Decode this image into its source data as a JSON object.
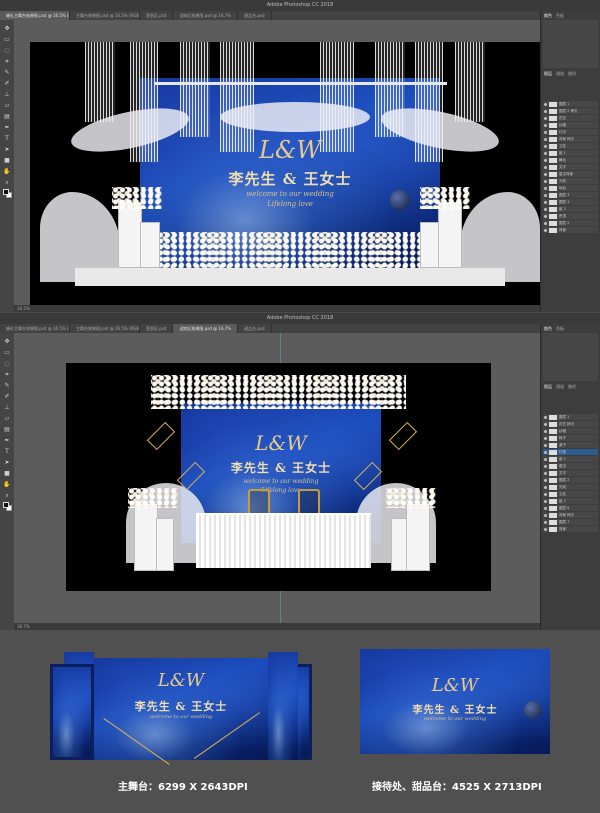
{
  "app": {
    "title": "Adobe Photoshop CC 2018",
    "tabs": [
      "婚礼主舞台效果图.psd @ 16.5% (图层 1, RGB/8)",
      "主舞台效果图.psd @ 16.5% (RGB/8)",
      "签到区.psd",
      "迎宾区效果图.psd @ 16.7%",
      "甜品台.psd"
    ],
    "tools": [
      "move-tool",
      "marquee-tool",
      "lasso-tool",
      "crop-tool",
      "eyedropper-tool",
      "brush-tool",
      "stamp-tool",
      "eraser-tool",
      "gradient-tool",
      "pen-tool",
      "text-tool",
      "path-tool",
      "shape-tool",
      "hand-tool",
      "zoom-tool"
    ],
    "panel_tabs_top": [
      "颜色",
      "色板"
    ],
    "panel_tabs_layers": [
      "图层",
      "通道",
      "路径"
    ],
    "status_top": "16.5%",
    "status_bottom": "16.7%"
  },
  "layers_top": [
    "图层 1",
    "图层 2 拷贝",
    "花艺",
    "纱幔",
    "灯光",
    "背景 拷贝",
    "立柱",
    "组 1",
    "舞台",
    "文字",
    "星空背景",
    "光效",
    "地台",
    "图层 3",
    "图层 4",
    "组 2",
    "吊顶",
    "图层 5",
    "背景"
  ],
  "layers_bottom": [
    "图层 1",
    "花艺 拷贝",
    "纱幔",
    "椅子",
    "桌子",
    "灯笼",
    "组 1",
    "星空",
    "文字",
    "图层 2",
    "光效",
    "立柱",
    "组 2",
    "图层 6",
    "背景 拷贝",
    "图层 7",
    "背景"
  ],
  "design": {
    "logo": "L&W",
    "names": "李先生 & 王女士",
    "subtitle_1": "welcome to our wedding",
    "subtitle_2": "Lifelong love"
  },
  "captions": {
    "main_stage": "主舞台：6299 X 2643DPI",
    "reception": "接待处、甜品台：4525 X 2713DPI"
  }
}
